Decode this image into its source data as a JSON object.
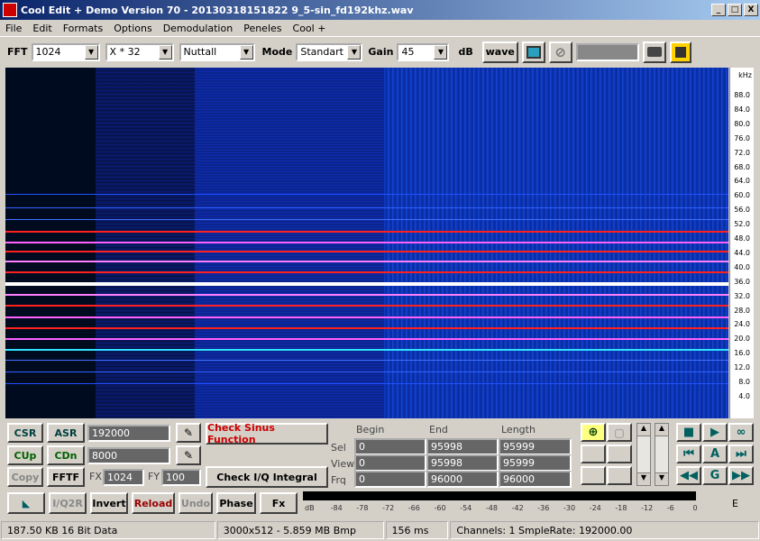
{
  "window": {
    "title": "Cool Edit + Demo Version 70 - 20130318151822 9_5-sin_fd192khz.wav",
    "min": "_",
    "max": "□",
    "close": "X"
  },
  "menu": [
    "File",
    "Edit",
    "Formats",
    "Options",
    "Demodulation",
    "Peneles",
    "Cool +"
  ],
  "toolbar": {
    "fft_label": "FFT",
    "fft_value": "1024",
    "x_value": "X * 32",
    "window_value": "Nuttall",
    "mode_label": "Mode",
    "mode_value": "Standart",
    "gain_label": "Gain",
    "gain_value": "45",
    "db_label": "dB",
    "wave_btn": "wave"
  },
  "khz": {
    "unit": "kHz",
    "ticks": [
      "88.0",
      "84.0",
      "80.0",
      "76.0",
      "72.0",
      "68.0",
      "64.0",
      "60.0",
      "56.0",
      "52.0",
      "48.0",
      "44.0",
      "40.0",
      "36.0",
      "32.0",
      "28.0",
      "24.0",
      "20.0",
      "16.0",
      "12.0",
      "8.0",
      "4.0"
    ]
  },
  "controls": {
    "csr": "CSR",
    "asr": "ASR",
    "asr_value": "192000",
    "cup": "CUp",
    "cdn": "CDn",
    "cdn_value": "8000",
    "copy": "Copy",
    "fftf": "FFTF",
    "fx_label": "FX",
    "fx_value": "1024",
    "fy_label": "FY",
    "fy_value": "100",
    "check_sinus": "Check Sinus Function",
    "check_iq": "Check I/Q Integral",
    "table": {
      "headers": [
        "Begin",
        "End",
        "Length"
      ],
      "rows": [
        {
          "label": "Sel",
          "values": [
            "0",
            "95998",
            "95999"
          ]
        },
        {
          "label": "View",
          "values": [
            "0",
            "95998",
            "95999"
          ]
        },
        {
          "label": "Frq",
          "values": [
            "0",
            "96000",
            "96000"
          ]
        }
      ]
    },
    "nav": {
      "a": "A",
      "g": "G"
    }
  },
  "bottom": {
    "iq2r": "I/Q2R",
    "invert": "Invert",
    "reload": "Reload",
    "undo": "Undo",
    "phase": "Phase",
    "fx": "Fx",
    "e": "E",
    "scale": [
      "dB",
      "-84",
      "-78",
      "-72",
      "-66",
      "-60",
      "-54",
      "-48",
      "-42",
      "-36",
      "-30",
      "-24",
      "-18",
      "-12",
      "-6",
      "0"
    ]
  },
  "status": [
    "187.50 KB 16 Bit Data",
    "3000x512 - 5.859 MB Bmp",
    "156 ms",
    "Channels: 1  SmpleRate: 192000.00"
  ],
  "colors": {
    "titlebar": "#0a246a",
    "spectrum_bg": "#00071a",
    "tone_red": "#ff2020",
    "tone_pink": "#ff80ff",
    "tone_white": "#ffffff",
    "tone_blue": "#2050ff",
    "check_sinus": "#cc0000"
  }
}
